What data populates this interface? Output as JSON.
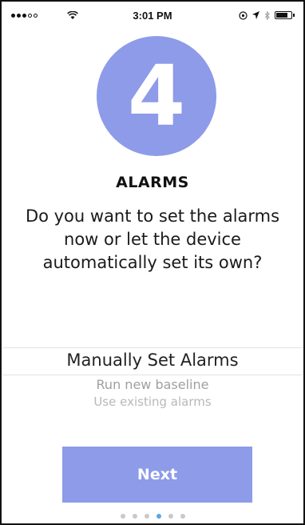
{
  "status_bar": {
    "time": "3:01 PM",
    "signal_icon": "signal-dots-icon",
    "wifi_icon": "wifi-icon",
    "right_icons": [
      "location-lock-icon",
      "location-arrow-icon",
      "bluetooth-icon",
      "battery-icon"
    ]
  },
  "step": {
    "number": "4",
    "color": "#8d9be8"
  },
  "title": "ALARMS",
  "question": "Do you want to set the alarms now or let the device automatically set its own?",
  "picker": {
    "selected": "Manually Set Alarms",
    "options": [
      "Run new baseline",
      "Use existing alarms"
    ]
  },
  "next_button": {
    "label": "Next",
    "color": "#8d9be8"
  },
  "pager": {
    "count": 6,
    "active_index": 3,
    "active_color": "#5aa7e6"
  }
}
